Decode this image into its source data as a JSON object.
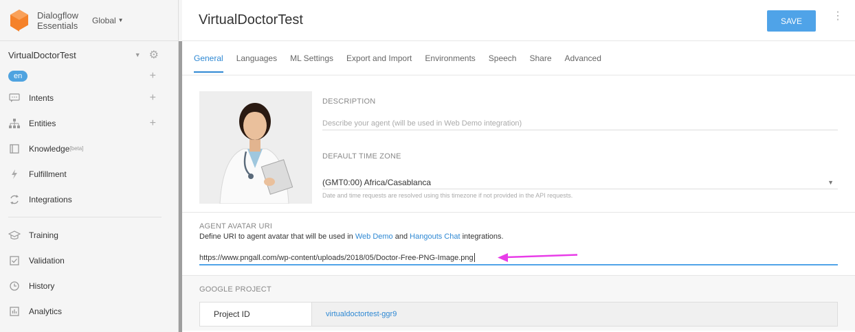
{
  "brand": {
    "line1": "Dialogflow",
    "line2": "Essentials",
    "region": "Global"
  },
  "agent": {
    "name": "VirtualDoctorTest",
    "language": "en"
  },
  "sidebar": {
    "items": [
      {
        "label": "Intents",
        "icon": "chat-bubble-icon",
        "addable": true
      },
      {
        "label": "Entities",
        "icon": "hierarchy-icon",
        "addable": true
      },
      {
        "label": "Knowledge",
        "badge": "[beta]",
        "icon": "book-icon"
      },
      {
        "label": "Fulfillment",
        "icon": "lightning-icon"
      },
      {
        "label": "Integrations",
        "icon": "sync-icon"
      }
    ],
    "items2": [
      {
        "label": "Training",
        "icon": "graduation-cap-icon"
      },
      {
        "label": "Validation",
        "icon": "checkbox-icon"
      },
      {
        "label": "History",
        "icon": "clock-icon"
      },
      {
        "label": "Analytics",
        "icon": "bar-chart-icon"
      }
    ]
  },
  "header": {
    "title": "VirtualDoctorTest",
    "save_label": "SAVE"
  },
  "tabs": [
    "General",
    "Languages",
    "ML Settings",
    "Export and Import",
    "Environments",
    "Speech",
    "Share",
    "Advanced"
  ],
  "general": {
    "description_label": "DESCRIPTION",
    "description_placeholder": "Describe your agent (will be used in Web Demo integration)",
    "timezone_label": "DEFAULT TIME ZONE",
    "timezone_value": "(GMT0:00) Africa/Casablanca",
    "timezone_hint": "Date and time requests are resolved using this timezone if not provided in the API requests."
  },
  "avatar_uri": {
    "label": "AGENT AVATAR URI",
    "desc_prefix": "Define URI to agent avatar that will be used in ",
    "link1": "Web Demo",
    "desc_mid": " and ",
    "link2": "Hangouts Chat",
    "desc_suffix": " integrations.",
    "value": "https://www.pngall.com/wp-content/uploads/2018/05/Doctor-Free-PNG-Image.png"
  },
  "google_project": {
    "label": "GOOGLE PROJECT",
    "key": "Project ID",
    "value": "virtualdoctortest-ggr9"
  },
  "colors": {
    "accent": "#4fa3e8",
    "link": "#2e88d3",
    "arrow": "#e83ce8",
    "logo": "#f5822a"
  }
}
